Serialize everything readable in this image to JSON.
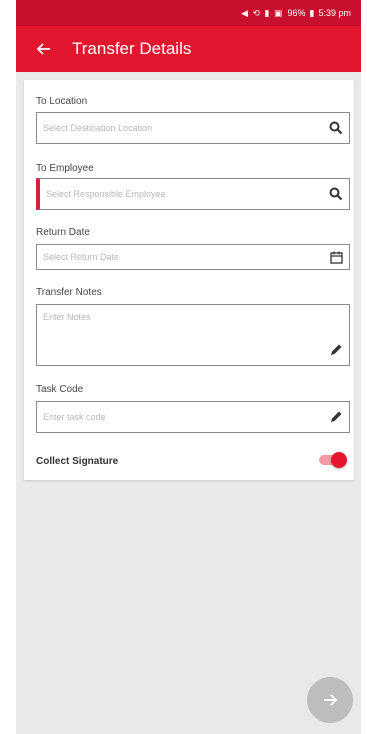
{
  "status_bar": {
    "icons": "◀ ⟲ ▮ ▣",
    "battery": "96%",
    "time": "5:39 pm"
  },
  "app_bar": {
    "title": "Transfer Details"
  },
  "form": {
    "to_location": {
      "label": "To Location",
      "placeholder": "Select Destination Location",
      "icon": "search-icon"
    },
    "to_employee": {
      "label": "To Employee",
      "placeholder": "Select Responsible Employee",
      "icon": "search-icon"
    },
    "return_date": {
      "label": "Return Date",
      "placeholder": "Select Return Date",
      "icon": "calendar-icon"
    },
    "transfer_notes": {
      "label": "Transfer Notes",
      "placeholder": "Enter Notes",
      "icon": "pencil-icon"
    },
    "task_code": {
      "label": "Task Code",
      "placeholder": "Enter task code",
      "icon": "pencil-icon"
    },
    "collect_signature": {
      "label": "Collect Signature",
      "enabled": true
    }
  },
  "colors": {
    "brand_red": "#e2172e",
    "statusbar_red": "#c8102e",
    "required_marker": "#d6203a",
    "fab_gray": "#bdbdbd"
  }
}
